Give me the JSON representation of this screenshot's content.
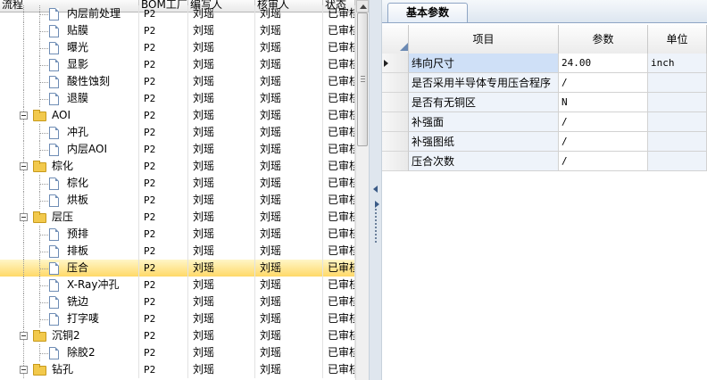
{
  "left_header": {
    "col_flow": "流程",
    "col_bom": "BOM工厂",
    "col_editor": "编写人",
    "col_reviewer": "核审人",
    "col_status": "状态"
  },
  "tree_rows": [
    {
      "kind": "doc",
      "level": 2,
      "label": "内层前处理",
      "bom": "P2",
      "editor": "刘瑶",
      "reviewer": "刘瑶",
      "status": "已审核"
    },
    {
      "kind": "doc",
      "level": 2,
      "label": "贴膜",
      "bom": "P2",
      "editor": "刘瑶",
      "reviewer": "刘瑶",
      "status": "已审核"
    },
    {
      "kind": "doc",
      "level": 2,
      "label": "曝光",
      "bom": "P2",
      "editor": "刘瑶",
      "reviewer": "刘瑶",
      "status": "已审核"
    },
    {
      "kind": "doc",
      "level": 2,
      "label": "显影",
      "bom": "P2",
      "editor": "刘瑶",
      "reviewer": "刘瑶",
      "status": "已审核"
    },
    {
      "kind": "doc",
      "level": 2,
      "label": "酸性蚀刻",
      "bom": "P2",
      "editor": "刘瑶",
      "reviewer": "刘瑶",
      "status": "已审核"
    },
    {
      "kind": "doc",
      "level": 2,
      "label": "退膜",
      "bom": "P2",
      "editor": "刘瑶",
      "reviewer": "刘瑶",
      "status": "已审核"
    },
    {
      "kind": "folder",
      "level": 1,
      "label": "AOI",
      "bom": "P2",
      "editor": "刘瑶",
      "reviewer": "刘瑶",
      "status": "已审核"
    },
    {
      "kind": "doc",
      "level": 2,
      "label": "冲孔",
      "bom": "P2",
      "editor": "刘瑶",
      "reviewer": "刘瑶",
      "status": "已审核"
    },
    {
      "kind": "doc",
      "level": 2,
      "label": "内层AOI",
      "bom": "P2",
      "editor": "刘瑶",
      "reviewer": "刘瑶",
      "status": "已审核"
    },
    {
      "kind": "folder",
      "level": 1,
      "label": "棕化",
      "bom": "P2",
      "editor": "刘瑶",
      "reviewer": "刘瑶",
      "status": "已审核"
    },
    {
      "kind": "doc",
      "level": 2,
      "label": "棕化",
      "bom": "P2",
      "editor": "刘瑶",
      "reviewer": "刘瑶",
      "status": "已审核"
    },
    {
      "kind": "doc",
      "level": 2,
      "label": "烘板",
      "bom": "P2",
      "editor": "刘瑶",
      "reviewer": "刘瑶",
      "status": "已审核"
    },
    {
      "kind": "folder",
      "level": 1,
      "label": "层压",
      "bom": "P2",
      "editor": "刘瑶",
      "reviewer": "刘瑶",
      "status": "已审核"
    },
    {
      "kind": "doc",
      "level": 2,
      "label": "预排",
      "bom": "P2",
      "editor": "刘瑶",
      "reviewer": "刘瑶",
      "status": "已审核"
    },
    {
      "kind": "doc",
      "level": 2,
      "label": "排板",
      "bom": "P2",
      "editor": "刘瑶",
      "reviewer": "刘瑶",
      "status": "已审核"
    },
    {
      "kind": "doc",
      "level": 2,
      "label": "压合",
      "bom": "P2",
      "editor": "刘瑶",
      "reviewer": "刘瑶",
      "status": "已审核",
      "selected": true
    },
    {
      "kind": "doc",
      "level": 2,
      "label": "X-Ray冲孔",
      "bom": "P2",
      "editor": "刘瑶",
      "reviewer": "刘瑶",
      "status": "已审核"
    },
    {
      "kind": "doc",
      "level": 2,
      "label": "铣边",
      "bom": "P2",
      "editor": "刘瑶",
      "reviewer": "刘瑶",
      "status": "已审核"
    },
    {
      "kind": "doc",
      "level": 2,
      "label": "打字唛",
      "bom": "P2",
      "editor": "刘瑶",
      "reviewer": "刘瑶",
      "status": "已审核"
    },
    {
      "kind": "folder",
      "level": 1,
      "label": "沉铜2",
      "bom": "P2",
      "editor": "刘瑶",
      "reviewer": "刘瑶",
      "status": "已审核"
    },
    {
      "kind": "doc",
      "level": 2,
      "label": "除胶2",
      "bom": "P2",
      "editor": "刘瑶",
      "reviewer": "刘瑶",
      "status": "已审核"
    },
    {
      "kind": "folder",
      "level": 1,
      "label": "钻孔",
      "bom": "P2",
      "editor": "刘瑶",
      "reviewer": "刘瑶",
      "status": "已审核"
    }
  ],
  "right_tab": {
    "label": "基本参数"
  },
  "param_header": {
    "item": "项目",
    "value": "参数",
    "unit": "单位"
  },
  "params": [
    {
      "item": "纬向尺寸",
      "value": "24.00",
      "unit": "inch",
      "current": true
    },
    {
      "item": "是否采用半导体专用压合程序",
      "value": "/",
      "unit": ""
    },
    {
      "item": "是否有无铜区",
      "value": "N",
      "unit": ""
    },
    {
      "item": "补强面",
      "value": "/",
      "unit": ""
    },
    {
      "item": "补强图纸",
      "value": "/",
      "unit": ""
    },
    {
      "item": "压合次数",
      "value": "/",
      "unit": ""
    }
  ],
  "colors": {
    "selected_row": "#ffd968",
    "item_cell_bg": "#eef3fa",
    "tab_border": "#8ea5c4"
  }
}
